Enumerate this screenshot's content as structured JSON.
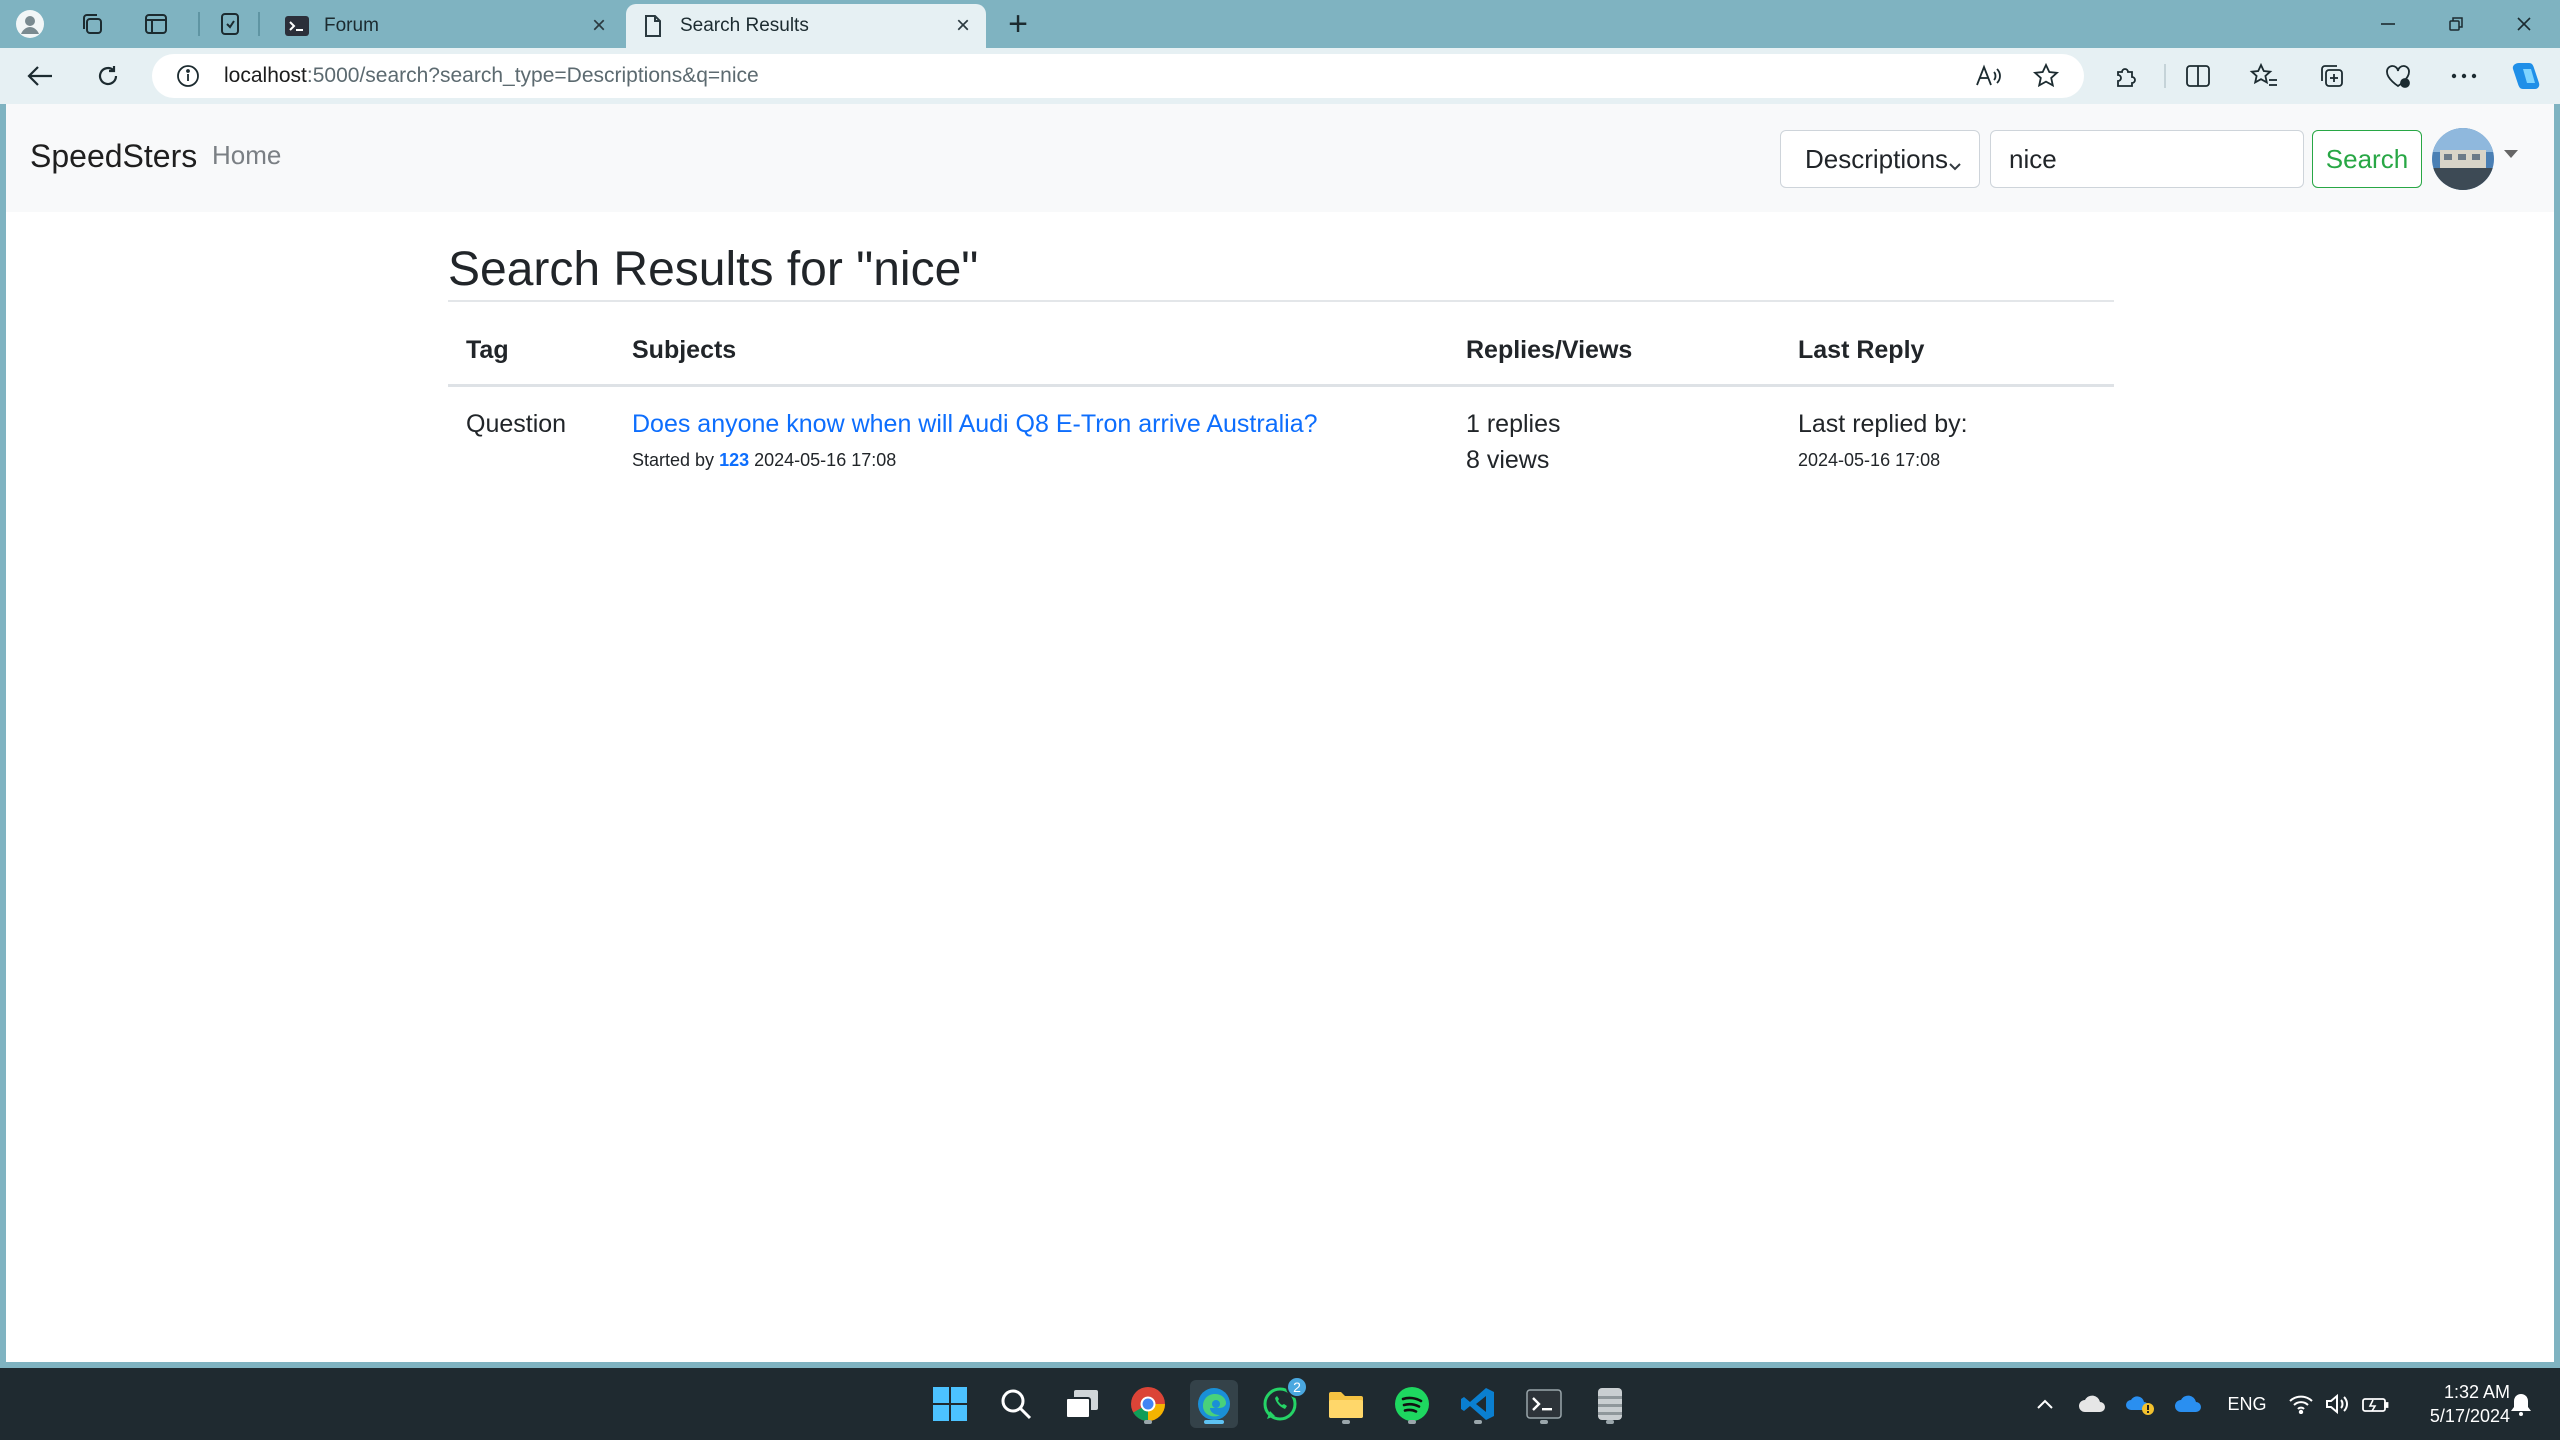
{
  "browser": {
    "tabs": [
      {
        "title": "Forum",
        "active": false
      },
      {
        "title": "Search Results",
        "active": true
      }
    ],
    "url_host": "localhost",
    "url_path": ":5000/search?search_type=Descriptions&q=nice"
  },
  "site": {
    "brand": "SpeedSters",
    "nav_home": "Home",
    "search": {
      "type_selected": "Descriptions",
      "query": "nice",
      "button_label": "Search"
    }
  },
  "page": {
    "title": "Search Results for \"nice\"",
    "columns": {
      "tag": "Tag",
      "subjects": "Subjects",
      "replies_views": "Replies/Views",
      "last_reply": "Last Reply"
    },
    "rows": [
      {
        "tag": "Question",
        "subject": "Does anyone know when will Audi Q8 E-Tron arrive Australia?",
        "started_by_label": "Started by",
        "author": "123",
        "started_at": "2024-05-16 17:08",
        "replies": "1 replies",
        "views": "8 views",
        "last_replied_label": "Last replied by:",
        "last_replied_at": "2024-05-16 17:08"
      }
    ]
  },
  "taskbar": {
    "language": "ENG",
    "time": "1:32 AM",
    "date": "5/17/2024",
    "whatsapp_badge": "2"
  },
  "colors": {
    "link": "#0d6efd",
    "search_button": "#28a745",
    "chrome_frame": "#7fb3c1",
    "taskbar": "#1f2a30"
  }
}
